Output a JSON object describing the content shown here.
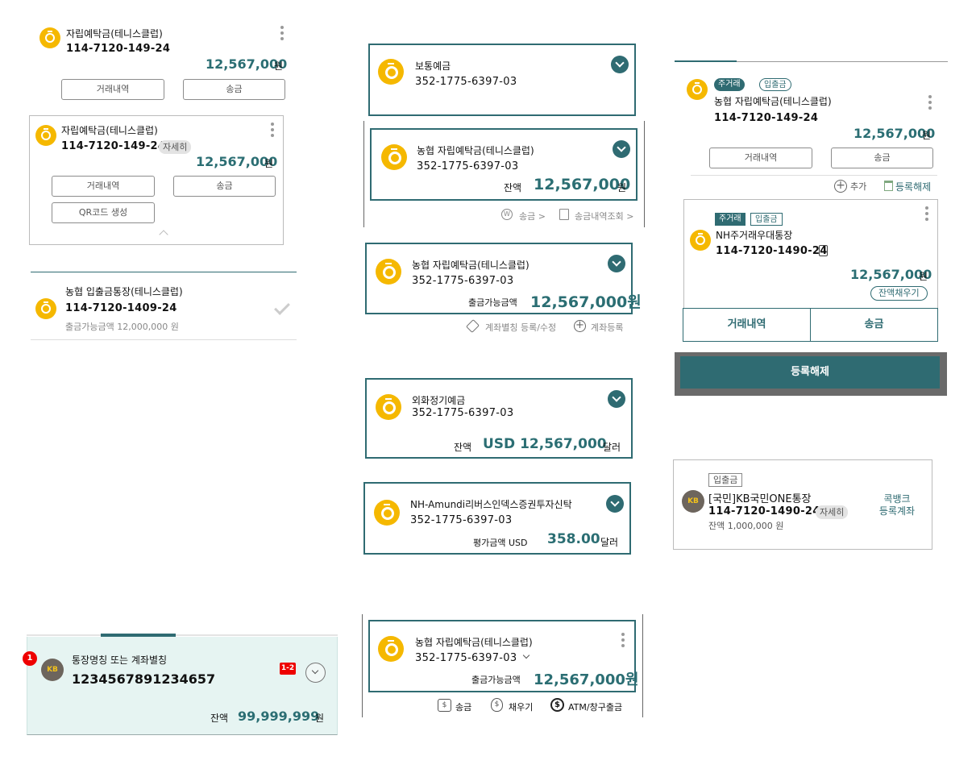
{
  "c1": {
    "name": "자립예탁금(테니스클럽)",
    "acct": "114-7120-149-24",
    "amount": "12,567,000",
    "unit": "원",
    "btn1": "거래내역",
    "btn2": "송금"
  },
  "c2": {
    "name": "자립예탁금(테니스클럽)",
    "acct": "114-7120-149-24",
    "detail": "자세히",
    "amount": "12,567,000",
    "unit": "원",
    "btn1": "거래내역",
    "btn2": "송금",
    "btn3": "QR코드 생성"
  },
  "c3": {
    "name": "농협 입출금통장(테니스클럽)",
    "acct": "114-7120-1409-24",
    "avail": "출금가능금액 12,000,000 원"
  },
  "c4": {
    "name": "통장명칭 또는 계좌별칭",
    "acct": "1234567891234657",
    "badge1": "1",
    "badge2": "1-2",
    "balance_label": "잔액",
    "amount": "99,999,999",
    "unit": "원"
  },
  "m1": {
    "name": "보통예금",
    "acct": "352-1775-6397-03"
  },
  "m2": {
    "name": "농협 자립예탁금(테니스클럽)",
    "acct": "352-1775-6397-03",
    "balance_label": "잔액",
    "amount": "12,567,000",
    "unit": "원",
    "link1": "송금 >",
    "link2": "송금내역조회 >"
  },
  "m3": {
    "name": "농협 자립예탁금(테니스클럽)",
    "acct": "352-1775-6397-03",
    "avail_label": "출금가능금액",
    "amount": "12,567,000원",
    "link1": "계좌별칭 등록/수정",
    "link2": "계좌등록"
  },
  "m4": {
    "name": "외화정기예금",
    "acct": "352-1775-6397-03",
    "balance_label": "잔액",
    "amount": "USD 12,567,000",
    "unit": "달러"
  },
  "m5": {
    "name": "NH-Amundi리버스인덱스증권투자신탁",
    "acct": "352-1775-6397-03",
    "eval_label": "평가금액 USD",
    "amount": "358.00",
    "unit": "달러"
  },
  "m6": {
    "name": "농협 자립예탁금(테니스클럽)",
    "acct": "352-1775-6397-03",
    "avail_label": "출금가능금액",
    "amount": "12,567,000원",
    "act1": "송금",
    "act2": "채우기",
    "act3": "ATM/창구출금"
  },
  "r1": {
    "tag1": "주거래",
    "tag2": "입출금",
    "name": "농협 자립예탁금(테니스클럽)",
    "acct": "114-7120-149-24",
    "amount": "12,567,000",
    "unit": "원",
    "btn1": "거래내역",
    "btn2": "송금",
    "add": "추가",
    "remove": "등록해제"
  },
  "r2": {
    "tag1": "주거래",
    "tag2": "입출금",
    "name": "NH주거래우대통장",
    "acct": "114-7120-1490-24",
    "amount": "12,567,000",
    "unit": "원",
    "fill": "잔액채우기",
    "btn1": "거래내역",
    "btn2": "송금",
    "unregister": "등록해제"
  },
  "r3": {
    "tag": "입출금",
    "name": "[국민]KB국민ONE통장",
    "acct": "114-7120-1490-24",
    "detail": "자세히",
    "balance": "잔액 1,000,000 원",
    "side": "콕뱅크\n등록계좌",
    "side1": "콕뱅크",
    "side2": "등록계좌"
  },
  "kb_logo": "KB",
  "colors": {
    "accent": "#2f6b72",
    "amount": "#2b6e73",
    "coin": "#f5b800",
    "mint": "#e6f4f2"
  }
}
